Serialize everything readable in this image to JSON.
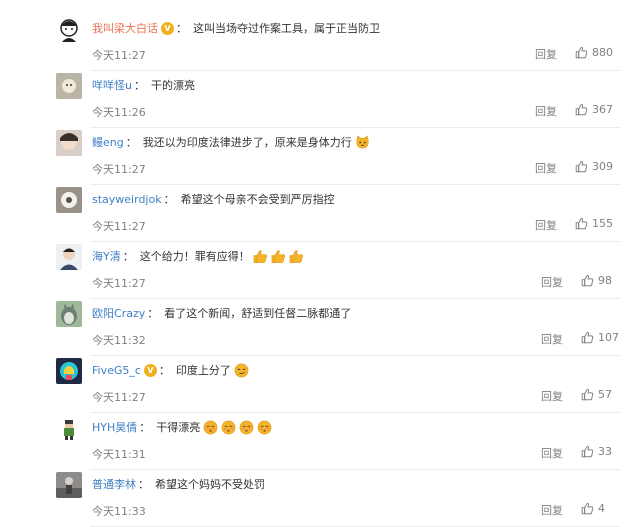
{
  "comments": [
    {
      "username": "我叫梁大白话",
      "verified": true,
      "text": "这叫当场夺过作案工具，属于正当防卫",
      "emojis": [],
      "time": "今天11:27",
      "reply": "回复",
      "likes": "880"
    },
    {
      "username": "咩咩怪u",
      "verified": false,
      "text": "干的漂亮",
      "emojis": [],
      "time": "今天11:26",
      "reply": "回复",
      "likes": "367"
    },
    {
      "username": "鳗eng",
      "verified": false,
      "text": "我还以为印度法律进步了，原来是身体力行",
      "emojis": [
        "cat-face-emoji"
      ],
      "time": "今天11:27",
      "reply": "回复",
      "likes": "309"
    },
    {
      "username": "stayweirdjok",
      "verified": false,
      "text": "希望这个母亲不会受到严厉指控",
      "emojis": [],
      "time": "今天11:27",
      "reply": "回复",
      "likes": "155"
    },
    {
      "username": "海Y清",
      "verified": false,
      "text": "这个给力！罪有应得！",
      "emojis": [
        "thumbs-up-emoji",
        "thumbs-up-emoji",
        "thumbs-up-emoji"
      ],
      "time": "今天11:27",
      "reply": "回复",
      "likes": "98"
    },
    {
      "username": "欧阳Crazy",
      "verified": false,
      "text": "看了这个新闻，舒适到任督二脉都通了",
      "emojis": [],
      "time": "今天11:32",
      "reply": "回复",
      "likes": "107"
    },
    {
      "username": "FiveG5_c",
      "verified": true,
      "text": "印度上分了",
      "emojis": [
        "smirk-face-emoji"
      ],
      "time": "今天11:27",
      "reply": "回复",
      "likes": "57"
    },
    {
      "username": "HYH昊倩",
      "verified": false,
      "text": "干得漂亮",
      "emojis": [
        "blush-face-emoji",
        "blush-face-emoji",
        "blush-face-emoji",
        "blush-face-emoji"
      ],
      "time": "今天11:31",
      "reply": "回复",
      "likes": "33"
    },
    {
      "username": "普通李林",
      "verified": false,
      "text": "希望这个妈妈不受处罚",
      "emojis": [],
      "time": "今天11:33",
      "reply": "回复",
      "likes": "4"
    }
  ],
  "colors": {
    "username": "#eb7350",
    "username_alt": "#3f80c6",
    "meta": "#808080",
    "verified": "#f0b01e",
    "emoji": "#f5b428"
  }
}
